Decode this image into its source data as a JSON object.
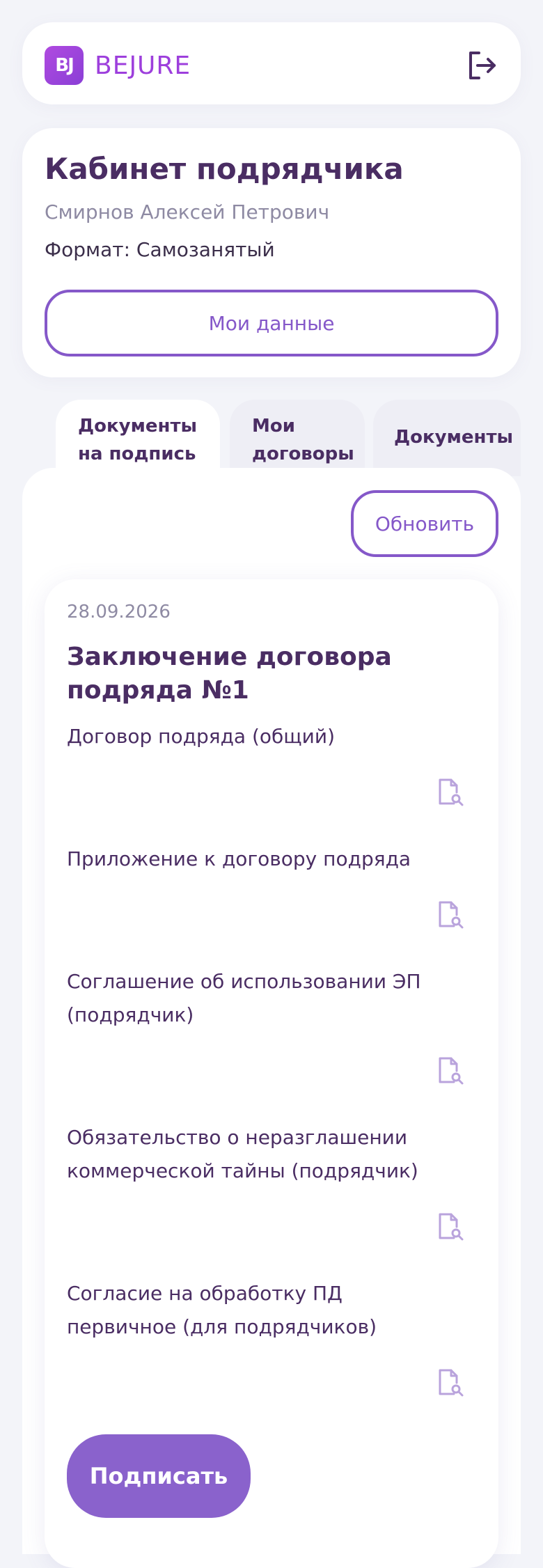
{
  "header": {
    "logo_mark": "BJ",
    "logo_text": "BEJURE",
    "logout_icon": "logout-icon"
  },
  "profile": {
    "title": "Кабинет подрядчика",
    "name": "Смирнов Алексей Петрович",
    "format": "Формат: Самозанятый",
    "my_data_button": "Мои данные"
  },
  "tabs": [
    {
      "line1": "Документы",
      "line2": "на подпись",
      "active": true
    },
    {
      "line1": "Мои",
      "line2": "договоры",
      "active": false
    },
    {
      "line1": "Документы",
      "line2": "",
      "active": false
    }
  ],
  "main": {
    "refresh_button": "Обновить",
    "document": {
      "date": "28.09.2026",
      "title": "Заключение договора подряда №1",
      "items": [
        {
          "name": "Договор подряда (общий)",
          "icon": "document-search-icon"
        },
        {
          "name": "Приложение к договору подряда",
          "icon": "document-search-icon"
        },
        {
          "name": "Соглашение об использовании ЭП (подрядчик)",
          "icon": "document-search-icon"
        },
        {
          "name": "Обязательство о неразглашении коммерческой тайны (подрядчик)",
          "icon": "document-search-icon"
        },
        {
          "name": "Согласие на обработку ПД первичное (для подрядчиков)",
          "icon": "document-search-icon"
        }
      ],
      "sign_button": "Подписать"
    }
  },
  "colors": {
    "accent": "#8558c9",
    "brand": "#9d3fdc",
    "text_dark": "#4a2d63",
    "text_muted": "#8e8aa3",
    "background": "#f3f4f9"
  }
}
